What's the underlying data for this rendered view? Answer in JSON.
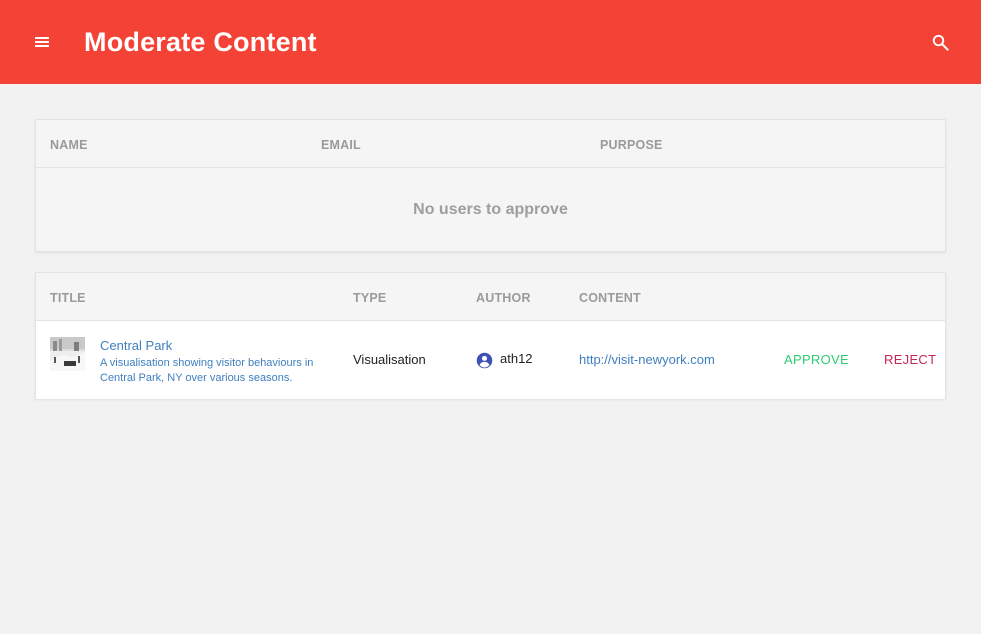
{
  "appbar": {
    "title": "Moderate Content",
    "menu_icon": "menu-icon",
    "search_icon": "search-icon",
    "color": "#f44336"
  },
  "users_table": {
    "columns": [
      "NAME",
      "EMAIL",
      "PURPOSE"
    ],
    "empty_message": "No users to approve"
  },
  "content_table": {
    "columns": [
      "TITLE",
      "TYPE",
      "AUTHOR",
      "CONTENT"
    ],
    "rows": [
      {
        "title": "Central Park",
        "description": "A visualisation showing visitor behaviours in Central Park, NY over various seasons.",
        "type": "Visualisation",
        "author": "ath12",
        "author_icon": "account-circle-icon",
        "content_url": "http://visit-newyork.com",
        "approve_label": "APPROVE",
        "reject_label": "REJECT"
      }
    ]
  },
  "colors": {
    "approve": "#2ecc71",
    "reject": "#c62850",
    "link": "#3f7fbf"
  }
}
